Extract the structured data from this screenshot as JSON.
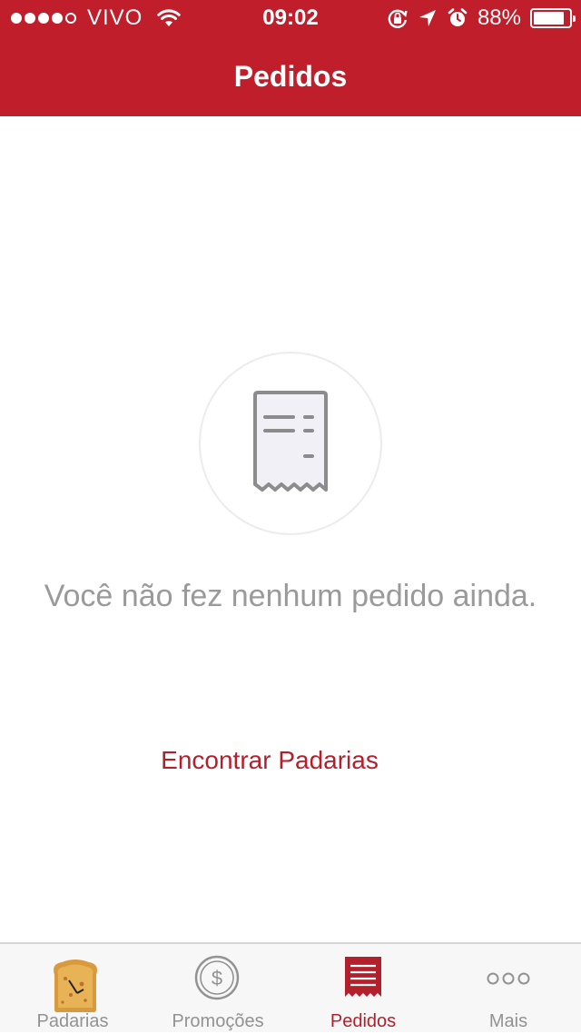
{
  "status_bar": {
    "carrier": "VIVO",
    "time": "09:02",
    "battery_percent": "88%",
    "battery_level": 0.88,
    "signal_bars_filled": 4,
    "signal_bars_total": 5
  },
  "nav": {
    "title": "Pedidos"
  },
  "empty_state": {
    "icon": "receipt-icon",
    "message": "Você não fez nenhum pedido ainda.",
    "action_label": "Encontrar Padarias"
  },
  "tab_bar": {
    "items": [
      {
        "label": "Padarias",
        "icon": "bread-icon",
        "active": false
      },
      {
        "label": "Promoções",
        "icon": "dollar-coin-icon",
        "active": false
      },
      {
        "label": "Pedidos",
        "icon": "receipt-icon",
        "active": true
      },
      {
        "label": "Mais",
        "icon": "more-icon",
        "active": false
      }
    ]
  },
  "colors": {
    "brand_red": "#bf1e2a",
    "link_red": "#b3202c",
    "muted_gray": "#9a9a9a",
    "tab_inactive": "#929292"
  }
}
